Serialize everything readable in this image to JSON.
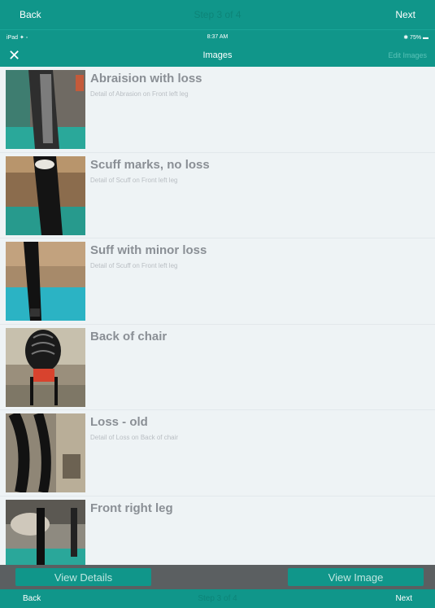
{
  "top_nav": {
    "back": "Back",
    "step": "Step 3 of 4",
    "next": "Next"
  },
  "status_bar": {
    "device": "iPad ✦ ◦",
    "time": "8:37 AM",
    "battery": "✱ 75% ▬"
  },
  "header": {
    "title": "Images",
    "edit": "Edit Images"
  },
  "images": [
    {
      "title": "Abraision with loss",
      "subtitle": "Detail of Abrasion on Front left leg"
    },
    {
      "title": "Scuff marks, no loss",
      "subtitle": "Detail of Scuff on Front left leg"
    },
    {
      "title": "Suff with minor loss",
      "subtitle": "Detail of Scuff on Front left leg"
    },
    {
      "title": "Back of chair",
      "subtitle": ""
    },
    {
      "title": "Loss - old",
      "subtitle": "Detail of Loss on Back of chair"
    },
    {
      "title": "Front right leg",
      "subtitle": ""
    }
  ],
  "bottom_bar": {
    "view_details": "View Details",
    "view_image": "View Image"
  },
  "bottom_nav": {
    "back": "Back",
    "step": "Step 3 of 4",
    "next": "Next"
  }
}
